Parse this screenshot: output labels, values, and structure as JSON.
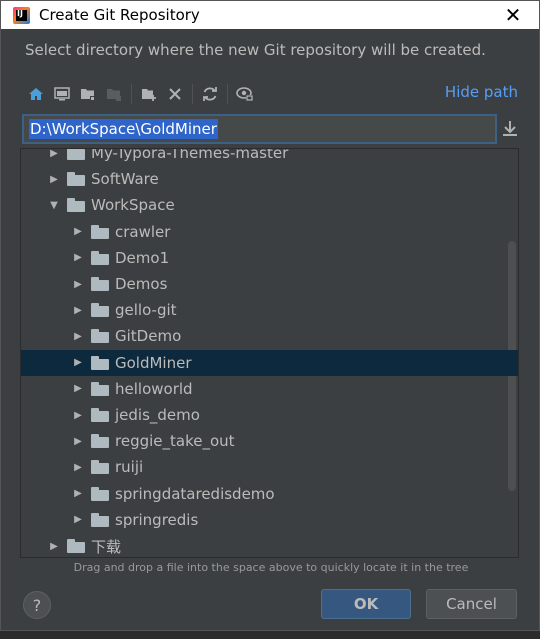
{
  "window": {
    "title": "Create Git Repository",
    "close_glyph": "✕"
  },
  "description": "Select directory where the new Git repository will be created.",
  "toolbar": {
    "icons": [
      "home-icon",
      "desktop-icon",
      "project-folder-icon",
      "module-folder-icon",
      "new-folder-icon",
      "delete-icon",
      "refresh-icon",
      "show-hidden-icon"
    ],
    "hide_path_label": "Hide path"
  },
  "path_field": {
    "value": "D:\\WorkSpace\\GoldMiner"
  },
  "tree": {
    "items": [
      {
        "label": "My-Typora-Themes-master",
        "depth": 0,
        "expanded": false
      },
      {
        "label": "SoftWare",
        "depth": 0,
        "expanded": false
      },
      {
        "label": "WorkSpace",
        "depth": 0,
        "expanded": true
      },
      {
        "label": "crawler",
        "depth": 1,
        "expanded": false
      },
      {
        "label": "Demo1",
        "depth": 1,
        "expanded": false
      },
      {
        "label": "Demos",
        "depth": 1,
        "expanded": false
      },
      {
        "label": "gello-git",
        "depth": 1,
        "expanded": false
      },
      {
        "label": "GitDemo",
        "depth": 1,
        "expanded": false
      },
      {
        "label": "GoldMiner",
        "depth": 1,
        "expanded": false,
        "selected": true
      },
      {
        "label": "helloworld",
        "depth": 1,
        "expanded": false
      },
      {
        "label": "jedis_demo",
        "depth": 1,
        "expanded": false
      },
      {
        "label": "reggie_take_out",
        "depth": 1,
        "expanded": false
      },
      {
        "label": "ruiji",
        "depth": 1,
        "expanded": false
      },
      {
        "label": "springdataredisdemo",
        "depth": 1,
        "expanded": false
      },
      {
        "label": "springredis",
        "depth": 1,
        "expanded": false
      },
      {
        "label": "下载",
        "depth": 0,
        "expanded": false
      }
    ]
  },
  "hint": "Drag and drop a file into the space above to quickly locate it in the tree",
  "buttons": {
    "help": "?",
    "ok": "OK",
    "cancel": "Cancel"
  },
  "colors": {
    "accent": "#589df6",
    "selection": "#0d293e",
    "ok_button": "#365880"
  }
}
